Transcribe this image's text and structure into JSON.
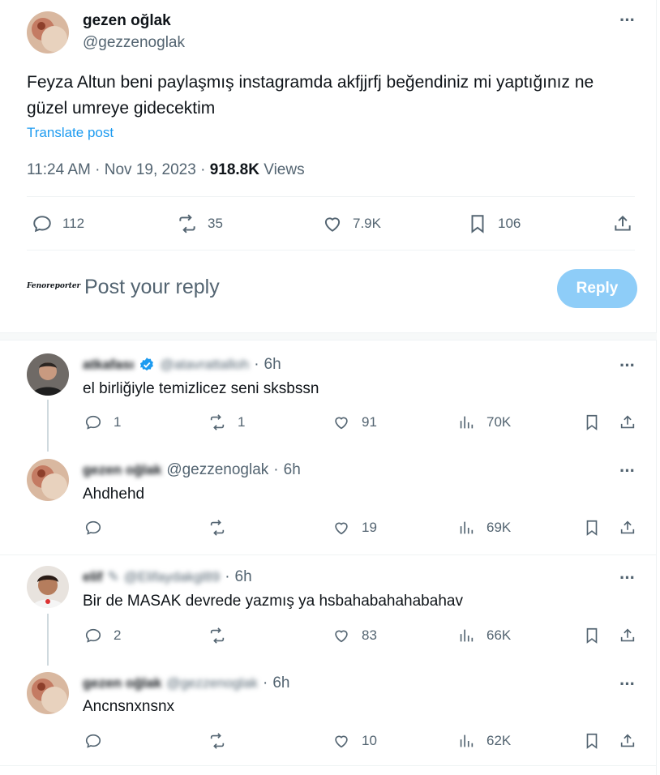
{
  "main_post": {
    "display_name": "gezen oğlak",
    "handle": "@gezzenoglak",
    "text": "Feyza Altun beni paylaşmış instagramda akfjjrfj beğendiniz mi yaptığınız ne güzel umreye gidecektim",
    "translate_label": "Translate post",
    "time": "11:24 AM",
    "date": "Nov 19, 2023",
    "separator": "·",
    "views_count": "918.8K",
    "views_label": "Views",
    "stats": {
      "replies": "112",
      "reposts": "35",
      "likes": "7.9K",
      "bookmarks": "106"
    }
  },
  "compose": {
    "avatar_text": "Fenoreporter",
    "placeholder": "Post your reply",
    "button_label": "Reply"
  },
  "replies": [
    {
      "display_name": "atkafası",
      "verified": true,
      "handle": "@atavrattalloh",
      "time": "6h",
      "text": "el birliğiyle temizlicez seni sksbssn",
      "replies": "1",
      "reposts": "1",
      "likes": "91",
      "views": "70K"
    },
    {
      "display_name": "gezen oğlak",
      "handle": "@gezzenoglak",
      "time": "6h",
      "text": "Ahdhehd",
      "replies": "",
      "reposts": "",
      "likes": "19",
      "views": "69K"
    },
    {
      "display_name": "elif",
      "handle": "@Elifaydakgl89",
      "time": "6h",
      "text": "Bir de MASAK devrede yazmış ya hsbahabahahabahav",
      "replies": "2",
      "reposts": "",
      "likes": "83",
      "views": "66K"
    },
    {
      "display_name": "gezen oğlak",
      "handle": "@gezzenoglak",
      "time": "6h",
      "text": "Ancnsnxnsnx",
      "replies": "",
      "reposts": "",
      "likes": "10",
      "views": "62K"
    }
  ],
  "icons": {
    "more": "more-dots-icon",
    "reply": "reply-bubble-icon",
    "repost": "repost-arrows-icon",
    "like": "heart-icon",
    "views": "views-bars-icon",
    "bookmark": "bookmark-icon",
    "share": "share-upload-icon",
    "verified": "verified-badge-icon"
  },
  "colors": {
    "accent": "#1d9bf0",
    "muted": "#536471",
    "reply_button": "#8ecdf8",
    "verified": "#1d9bf0"
  }
}
